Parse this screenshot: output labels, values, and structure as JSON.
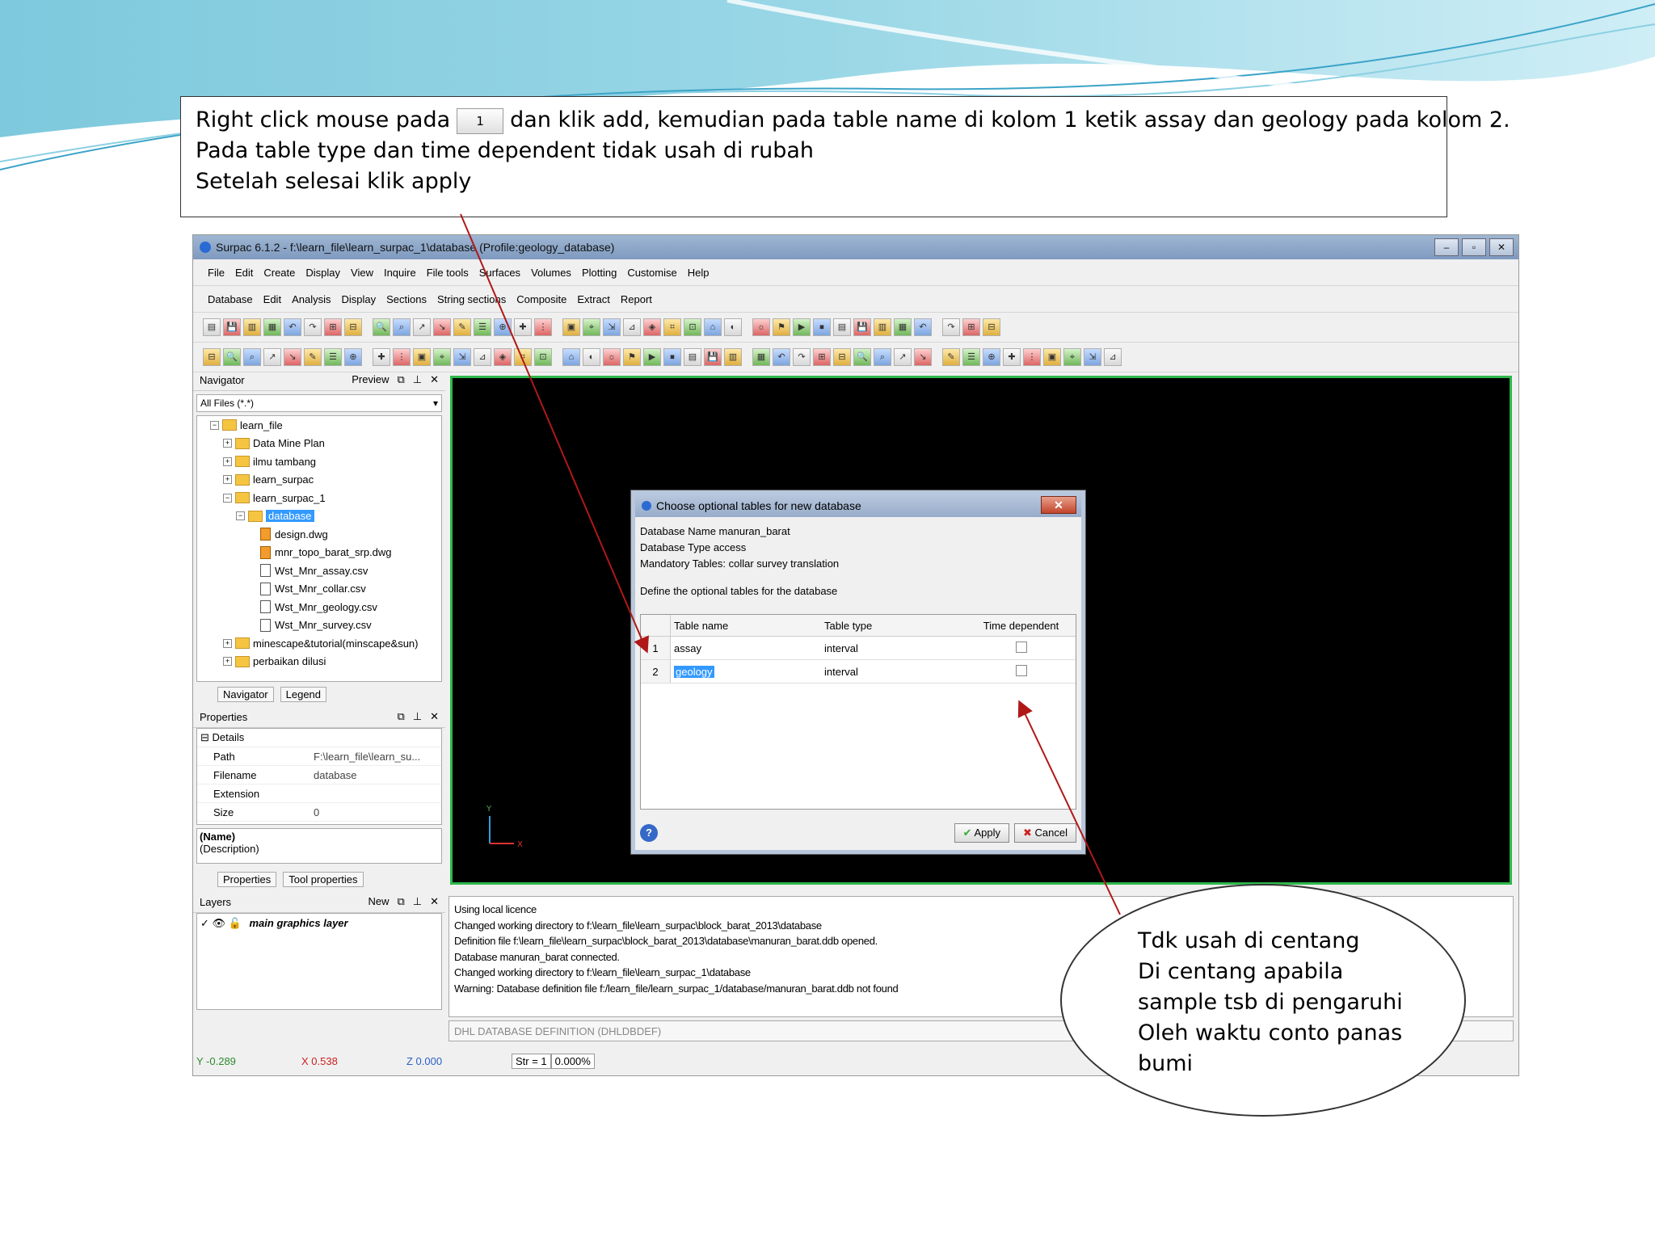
{
  "instruction": {
    "line1_before": "Right click mouse pada",
    "line1_button": "1",
    "line1_after": "dan klik add, kemudian pada table name di kolom 1 ketik assay dan geology pada kolom 2.",
    "line2": "Pada table type dan time dependent tidak usah di rubah",
    "line3": "Setelah selesai klik apply"
  },
  "app": {
    "title": "Surpac 6.1.2 - f:\\learn_file\\learn_surpac_1\\database (Profile:geology_database)",
    "window_controls": [
      "–",
      "▫",
      "✕"
    ],
    "menu1": [
      "File",
      "Edit",
      "Create",
      "Display",
      "View",
      "Inquire",
      "File tools",
      "Surfaces",
      "Volumes",
      "Plotting",
      "Customise",
      "Help"
    ],
    "menu2": [
      "Database",
      "Edit",
      "Analysis",
      "Display",
      "Sections",
      "String sections",
      "Composite",
      "Extract",
      "Report"
    ]
  },
  "navigator": {
    "title": "Navigator",
    "preview": "Preview",
    "controls": [
      "⧉",
      "⊥",
      "✕"
    ],
    "filter": "All Files (*.*)",
    "tree": [
      {
        "label": "learn_file",
        "type": "folder",
        "indent": 1,
        "expander": "−"
      },
      {
        "label": "Data Mine Plan",
        "type": "folder",
        "indent": 2,
        "expander": "+"
      },
      {
        "label": "ilmu tambang",
        "type": "folder",
        "indent": 2,
        "expander": "+"
      },
      {
        "label": "learn_surpac",
        "type": "folder",
        "indent": 2,
        "expander": "+"
      },
      {
        "label": "learn_surpac_1",
        "type": "folder",
        "indent": 2,
        "expander": "−"
      },
      {
        "label": "database",
        "type": "folder",
        "indent": 3,
        "expander": "−",
        "selected": true
      },
      {
        "label": "design.dwg",
        "type": "dwg",
        "indent": 4
      },
      {
        "label": "mnr_topo_barat_srp.dwg",
        "type": "dwg",
        "indent": 4
      },
      {
        "label": "Wst_Mnr_assay.csv",
        "type": "file",
        "indent": 4
      },
      {
        "label": "Wst_Mnr_collar.csv",
        "type": "file",
        "indent": 4
      },
      {
        "label": "Wst_Mnr_geology.csv",
        "type": "file",
        "indent": 4
      },
      {
        "label": "Wst_Mnr_survey.csv",
        "type": "file",
        "indent": 4
      },
      {
        "label": "minescape&tutorial(minscape&sun)",
        "type": "folder",
        "indent": 2,
        "expander": "+"
      },
      {
        "label": "perbaikan dilusi",
        "type": "folder",
        "indent": 2,
        "expander": "+"
      }
    ],
    "tabs": [
      "Navigator",
      "Legend"
    ]
  },
  "properties": {
    "title": "Properties",
    "section": "Details",
    "rows": [
      {
        "key": "Path",
        "value": "F:\\learn_file\\learn_su..."
      },
      {
        "key": "Filename",
        "value": "database"
      },
      {
        "key": "Extension",
        "value": ""
      },
      {
        "key": "Size",
        "value": "0"
      }
    ],
    "name_label": "(Name)",
    "desc_label": "(Description)",
    "tabs": [
      "Properties",
      "Tool properties"
    ]
  },
  "layers": {
    "title": "Layers",
    "new": "New",
    "item": "main graphics layer"
  },
  "dialog": {
    "title": "Choose optional tables for new database",
    "close": "✕",
    "db_name": "Database Name  manuran_barat",
    "db_type": "Database Type  access",
    "mandatory": "Mandatory Tables: collar  survey  translation",
    "define": "Define the optional tables for the database",
    "columns": [
      "Table name",
      "Table type",
      "Time dependent"
    ],
    "rows": [
      {
        "num": "1",
        "name": "assay",
        "type": "interval"
      },
      {
        "num": "2",
        "name": "geology",
        "type": "interval"
      }
    ],
    "apply": "Apply",
    "cancel": "Cancel",
    "help": "?"
  },
  "console": {
    "lines": [
      "Using local licence",
      "Changed working directory to f:\\learn_file\\learn_surpac\\block_barat_2013\\database",
      "Definition file f:\\learn_file\\learn_surpac\\block_barat_2013\\database\\manuran_barat.ddb opened.",
      "Database manuran_barat connected.",
      "Changed working directory to f:\\learn_file\\learn_surpac_1\\database",
      "Warning: Database definition file f:/learn_file/learn_surpac_1/database/manuran_barat.ddb not found"
    ],
    "command": "DHL DATABASE DEFINITION (DHLDBDEF)"
  },
  "status": {
    "y": "Y -0.289",
    "x": "X 0.538",
    "z": "Z 0.000",
    "str": "Str = 1",
    "pct": "0.000%"
  },
  "callout": {
    "lines": [
      "Tdk usah di centang",
      "Di centang apabila",
      "sample tsb di pengaruhi",
      "Oleh waktu conto panas",
      "bumi"
    ]
  },
  "colors": {
    "accent_wave": "#6fc2dc",
    "viewport_border": "#2fb84b",
    "arrow": "#b01818",
    "selection": "#3399ff"
  }
}
